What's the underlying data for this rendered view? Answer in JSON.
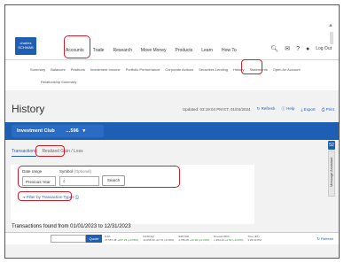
{
  "logo": {
    "line1": "charles",
    "line2": "SCHWAB"
  },
  "nav": {
    "items": [
      "Accounts",
      "Trade",
      "Research",
      "Move Money",
      "Products",
      "Learn",
      "How To"
    ],
    "logout": "Log Out"
  },
  "subnav": {
    "items": [
      "Summary",
      "Balances",
      "Positions",
      "Investment Income",
      "Portfolio Performance",
      "Corporate Actions",
      "Securities Lending",
      "History",
      "Statements",
      "Open An Account"
    ],
    "row2": "Relationship Summary"
  },
  "page": {
    "title": "History",
    "updated": "Updated: 03:19:04 PM ET, 01/04/2024",
    "refresh": "Refresh",
    "help": "Help",
    "export": "Export",
    "print": "Print"
  },
  "account": {
    "name": "Investment Club",
    "number": "…596",
    "chevron": "▾"
  },
  "side": {
    "badge": "52",
    "tab": "Message Assistant"
  },
  "tabs": {
    "transactions": "Transactions",
    "realized": "Realized Gain / Loss"
  },
  "filters": {
    "date_label": "Date range",
    "symbol_label": "Symbol",
    "symbol_optional": "(Optional)",
    "date_value": "Previous Year",
    "symbol_placeholder": "",
    "search_button": "Search",
    "filter_type": "Filter by Transaction Types"
  },
  "results": {
    "found_text": "Transactions found from 01/01/2023 to 12/31/2023"
  },
  "quotebar": {
    "button": "Quote",
    "tickers": [
      {
        "label": "DJIA",
        "value": "37,557.48",
        "change": "+207.29 (+0.56%)"
      },
      {
        "label": "NASDAQ",
        "value": "14,658.49",
        "change": "-22.79 (-0.16%)"
      },
      {
        "label": "S&P 500",
        "value": "4,756.05",
        "change": "+10.99 (+0.23%)"
      },
      {
        "label": "Russell 2000",
        "value": "1,994.43",
        "change": "+0.52 (+0.03%)"
      },
      {
        "label": "Time (ET)",
        "value": "3:29:03 PM",
        "change": ""
      }
    ],
    "refresh": "Refresh"
  },
  "colors": {
    "brand": "#1f5fb3",
    "highlight": "#c8202a"
  }
}
